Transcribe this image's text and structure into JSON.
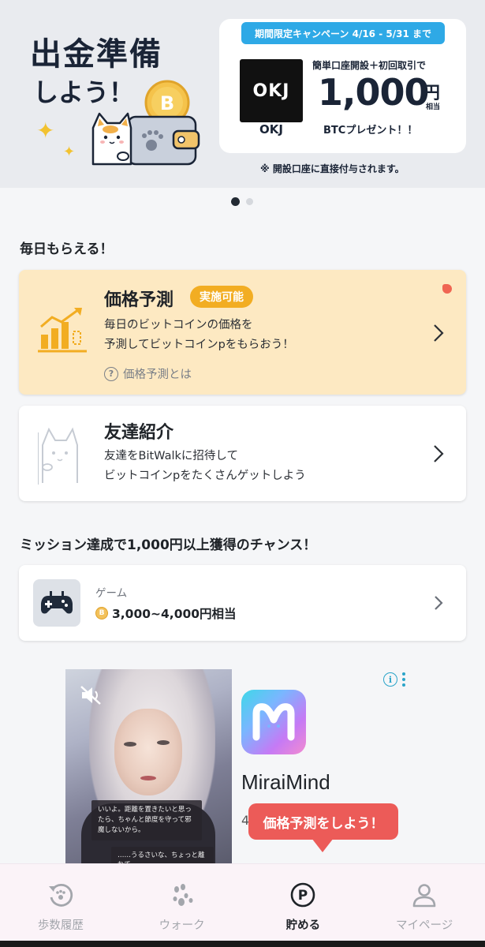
{
  "banner": {
    "title_line1": "出金準備",
    "title_line2": "しよう！",
    "campaign_header": "期間限定キャンペーン 4/16 - 5/31 まで",
    "logo_text": "OKJ",
    "brand_name": "OKJ",
    "promo_line1": "簡単口座開設＋初回取引で",
    "promo_amount": "1,000",
    "promo_yen": "円",
    "promo_equiv": "相当",
    "promo_line3": "BTCプレゼント！！",
    "note": "※ 開設口座に直接付与されます。"
  },
  "carousel": {
    "total": 2,
    "active_index": 0
  },
  "daily": {
    "heading": "毎日もらえる！",
    "price_card": {
      "title": "価格予測",
      "badge": "実施可能",
      "desc_line1": "毎日のビットコインの価格を",
      "desc_line2": "予測してビットコインpをもらおう！",
      "help_link": "価格予測とは",
      "help_symbol": "?"
    },
    "friend_card": {
      "title": "友達紹介",
      "desc_line1": "友達をBitWalkに招待して",
      "desc_line2": "ビットコインpをたくさんゲットしよう"
    }
  },
  "mission": {
    "heading": "ミッション達成で1,000円以上獲得のチャンス！",
    "game_card": {
      "label": "ゲーム",
      "coin_symbol": "B",
      "reward": "3,000~4,000円相当"
    }
  },
  "ad": {
    "subtitle1": "いいよ。距離を置きたいと思ったら、ちゃんと節度を守って邪魔しないから。",
    "subtitle2": "……うるさいな、ちょっと離れて",
    "app_name": "MiraiMind",
    "rating_partial": "4",
    "info_symbol": "i"
  },
  "tooltip": {
    "text": "価格予測をしよう！"
  },
  "nav": {
    "items": [
      {
        "label": "歩数履歴",
        "icon": "history-icon"
      },
      {
        "label": "ウォーク",
        "icon": "paw-icon"
      },
      {
        "label": "貯める",
        "icon": "point-icon",
        "symbol": "P"
      },
      {
        "label": "マイページ",
        "icon": "person-icon"
      }
    ],
    "active_index": 2
  },
  "colors": {
    "accent_orange": "#f2ad22",
    "price_card_bg": "#fde9c2",
    "campaign_blue": "#2ea9e6",
    "tooltip_red": "#ec5b58"
  }
}
